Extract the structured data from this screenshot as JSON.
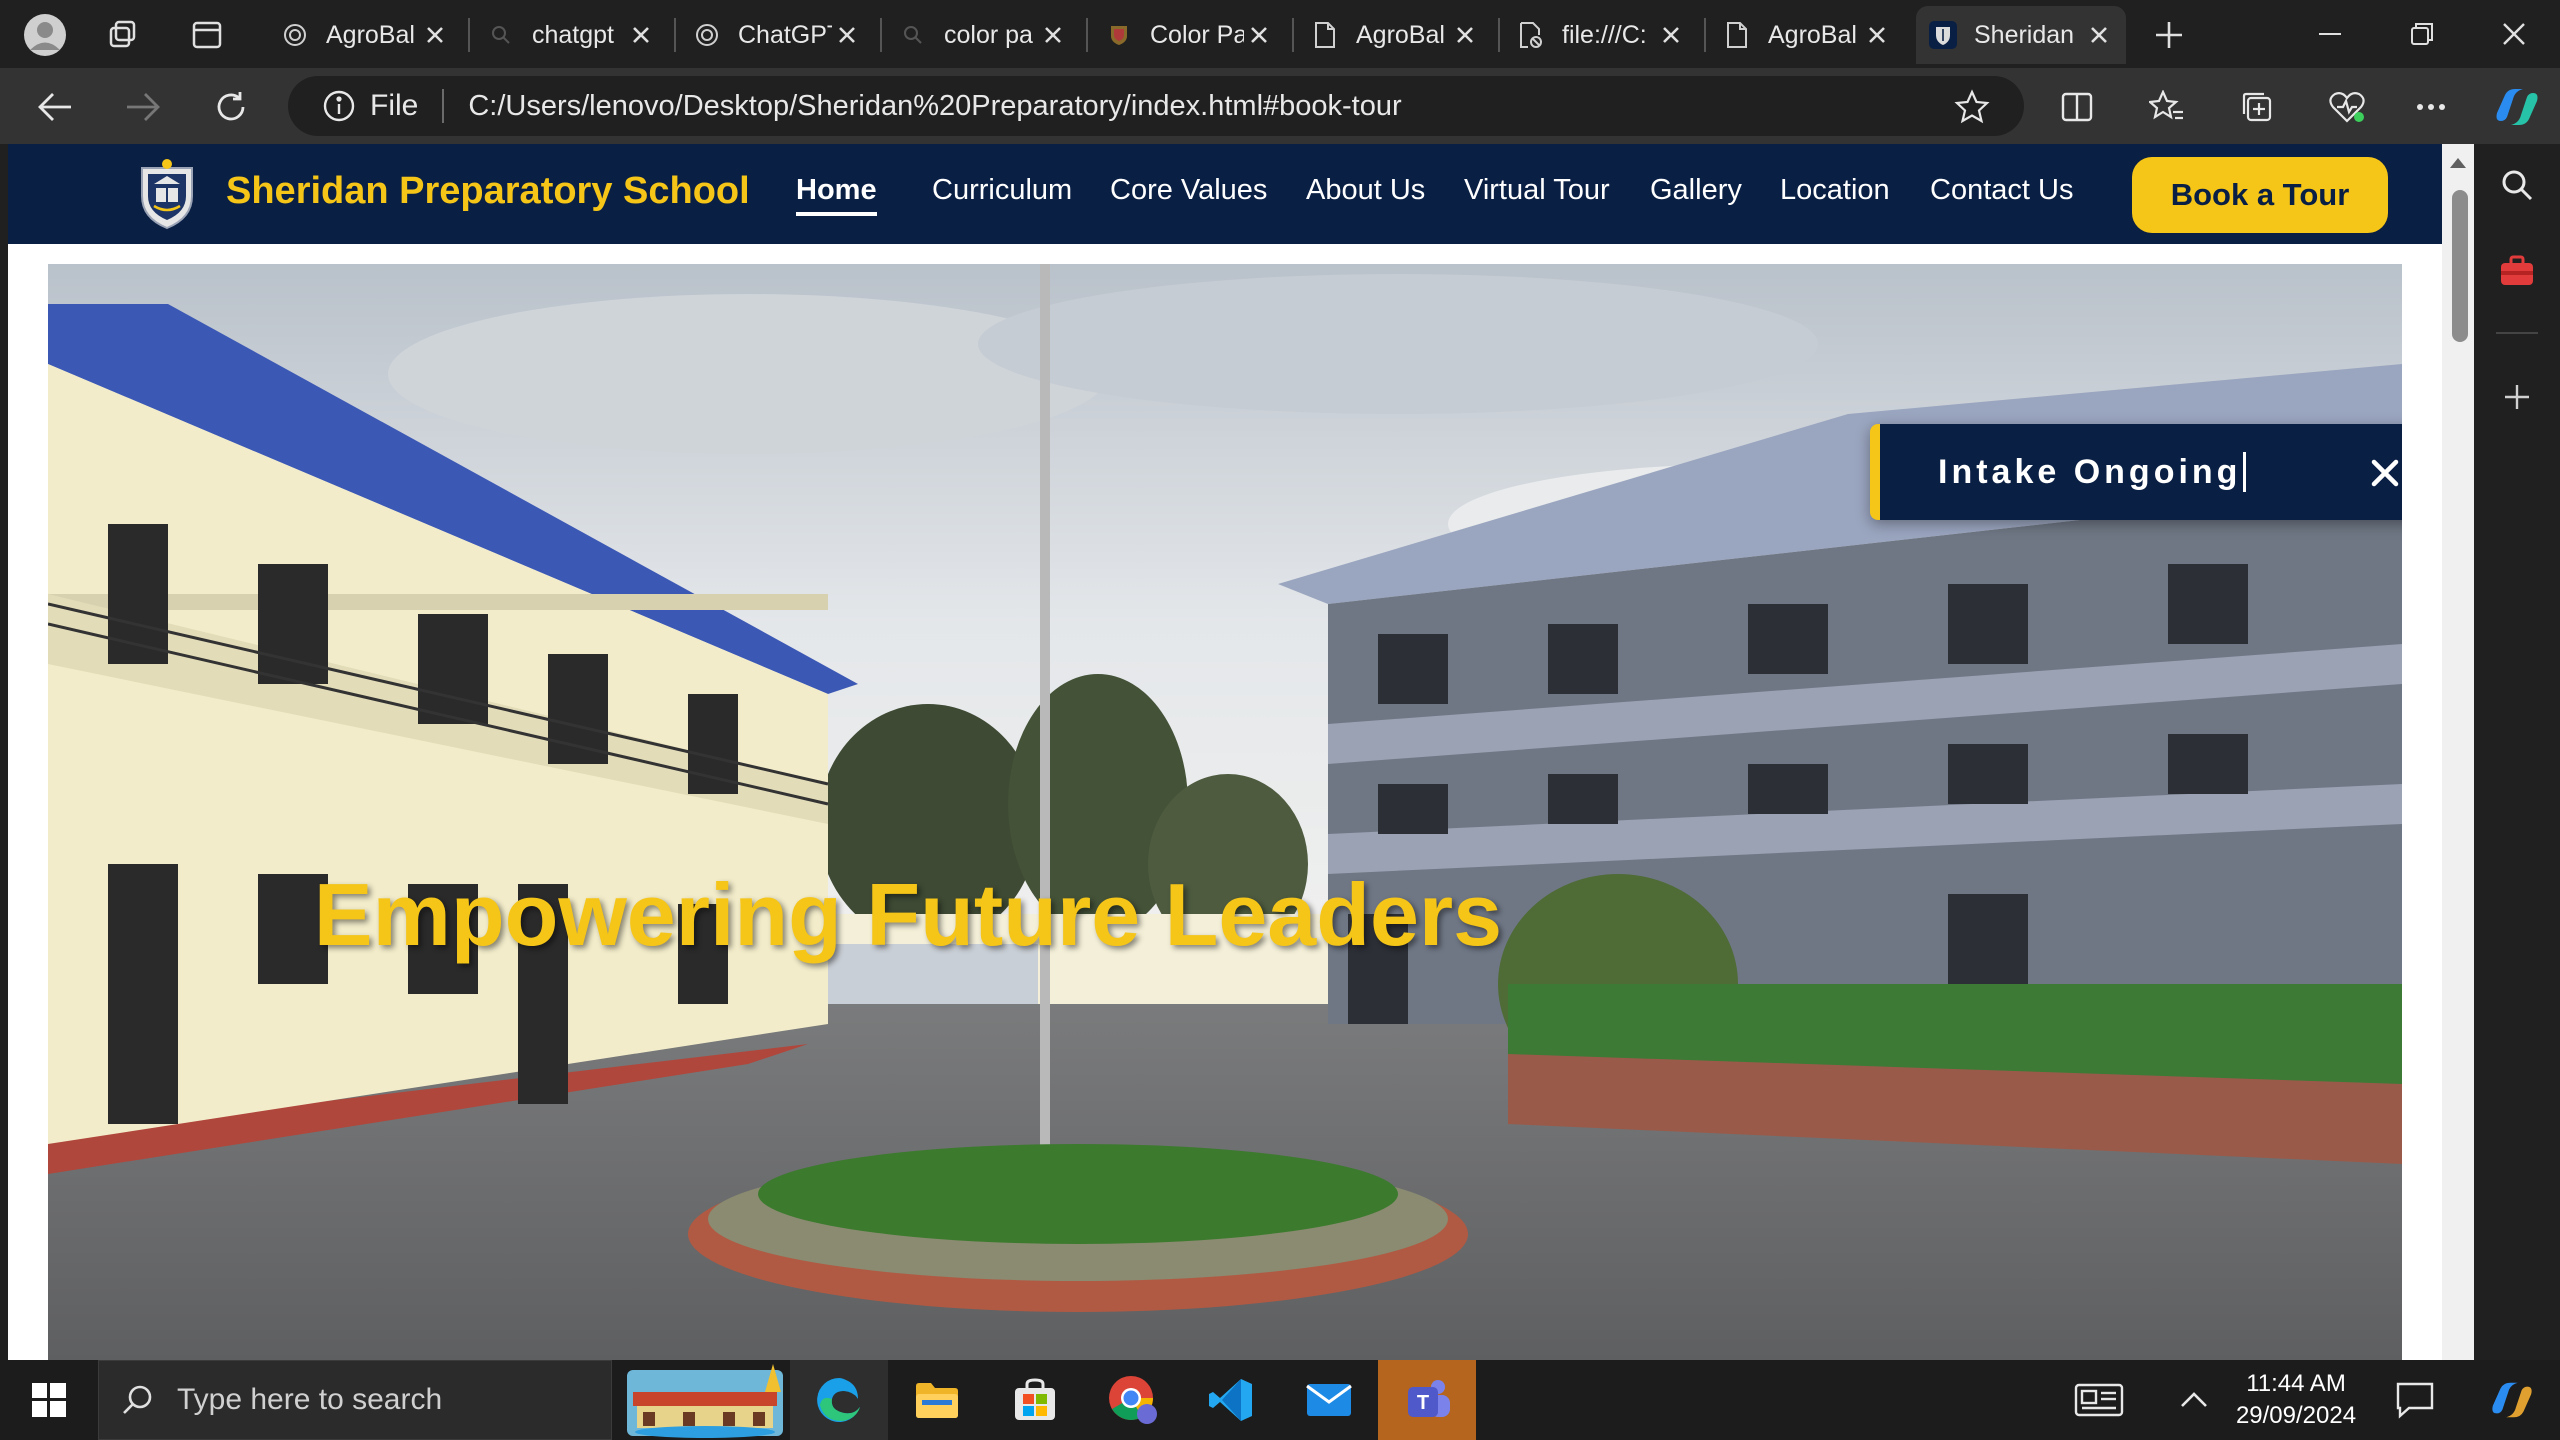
{
  "browser": {
    "tabs": [
      {
        "label": "AgroBal",
        "icon": "openai-icon"
      },
      {
        "label": "chatgpt",
        "icon": "search-icon"
      },
      {
        "label": "ChatGPT",
        "icon": "openai-icon"
      },
      {
        "label": "color pa",
        "icon": "search-icon"
      },
      {
        "label": "Color Pa",
        "icon": "shield-icon"
      },
      {
        "label": "AgroBal",
        "icon": "document-icon"
      },
      {
        "label": "file:///C:",
        "icon": "broken-document-icon"
      },
      {
        "label": "AgroBal",
        "icon": "document-icon"
      },
      {
        "label": "Sheridan",
        "icon": "school-crest-icon",
        "active": true
      }
    ],
    "address": {
      "protocol_label": "File",
      "url": "C:/Users/lenovo/Desktop/Sheridan%20Preparatory/index.html#book-tour"
    },
    "accent_color": "#202020"
  },
  "site": {
    "school_name": "Sheridan Preparatory School",
    "menu": [
      "Home",
      "Curriculum",
      "Core Values",
      "About Us",
      "Virtual Tour",
      "Gallery",
      "Location",
      "Contact Us"
    ],
    "active_menu_item": "Home",
    "cta_label": "Book a Tour",
    "hero_title": "Empowering Future Leaders",
    "toast_text": "Intake Ongoing",
    "colors": {
      "navy": "#0a1f44",
      "gold": "#f5c518"
    }
  },
  "taskbar": {
    "search_placeholder": "Type here to search",
    "time": "11:44 AM",
    "date": "29/09/2024",
    "apps": [
      "widget-game-icon",
      "edge-icon",
      "file-explorer-icon",
      "microsoft-store-icon",
      "chrome-icon",
      "vscode-icon",
      "mail-icon",
      "teams-icon"
    ]
  }
}
